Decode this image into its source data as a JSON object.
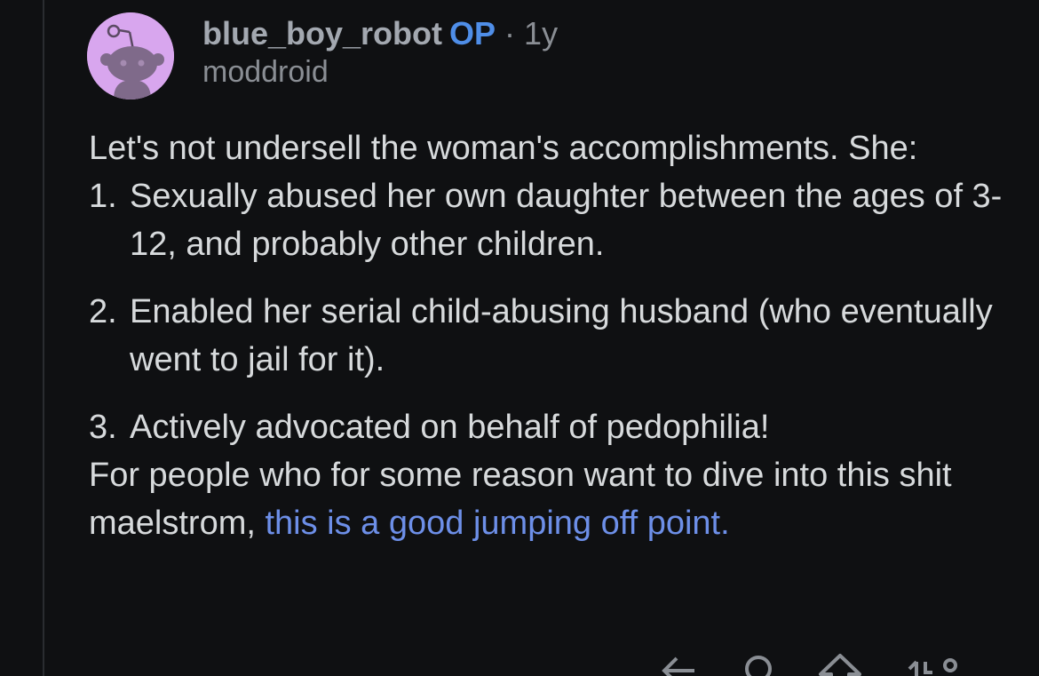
{
  "comment": {
    "author": "blue_boy_robot",
    "op_badge": "OP",
    "separator": "·",
    "age": "1y",
    "flair": "moddroid",
    "intro": "Let's not undersell the woman's accomplishments. She:",
    "list_items": [
      {
        "number": "1.",
        "text": "Sexually abused her own daughter between the ages of 3-12, and probably other children."
      },
      {
        "number": "2.",
        "text": "Enabled her serial child-abusing husband (who eventually went to jail for it)."
      },
      {
        "number": "3.",
        "text": "Actively advocated on behalf of pedophilia!"
      }
    ],
    "outro_text": "For people who for some reason want to dive into this shit maelstrom, ",
    "link_text": "this is a good jumping off point."
  },
  "actions": {
    "icons": [
      "reply-icon",
      "award-icon",
      "upvote-icon",
      "more-icon"
    ]
  },
  "colors": {
    "background": "#0f1012",
    "text": "#d7dadc",
    "muted": "#8a8e94",
    "username": "#a3a8b0",
    "op": "#4f8ee8",
    "link": "#6d8fe8",
    "avatar_bg": "#d8a6ee"
  }
}
